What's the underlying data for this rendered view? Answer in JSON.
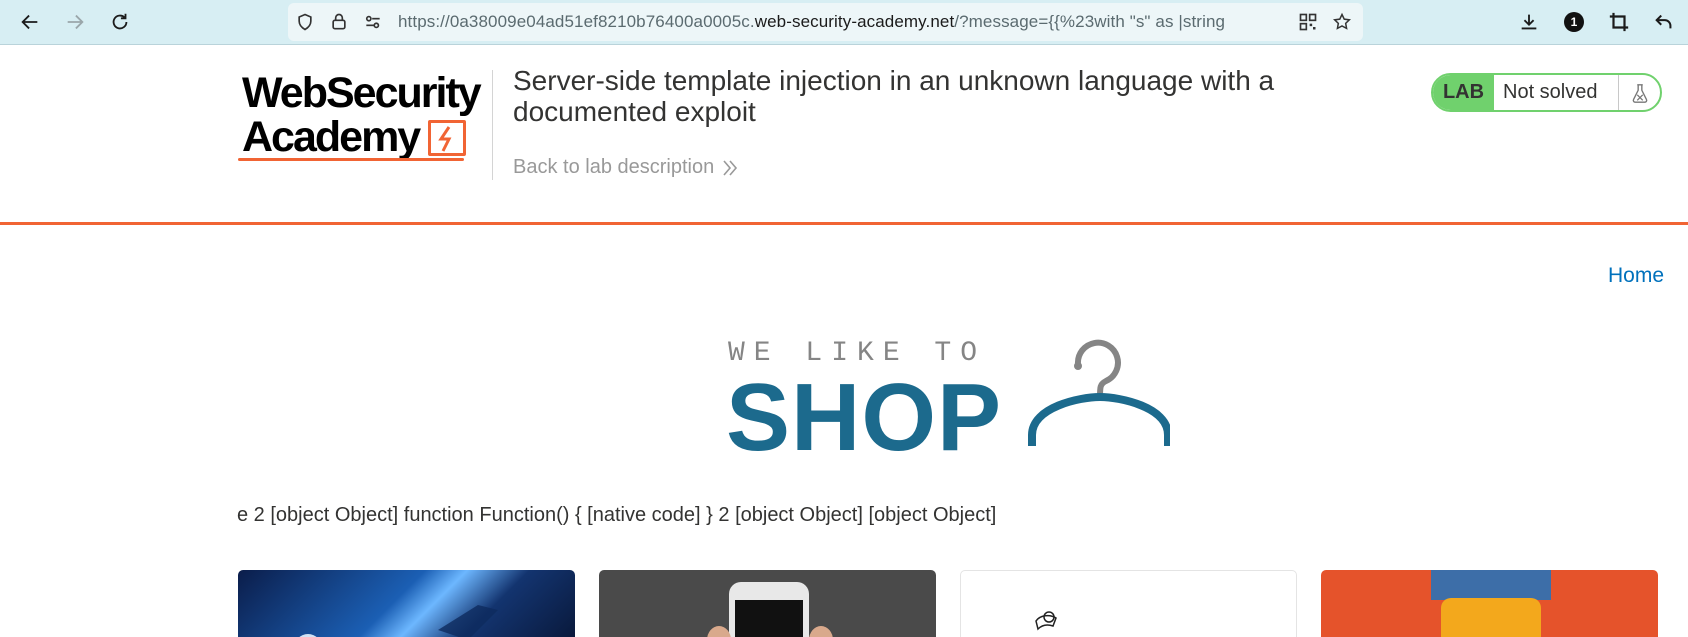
{
  "browser": {
    "url_prefix": "https://0a38009e04ad51ef8210b76400a0005c.",
    "url_host": "web-security-academy.net",
    "url_rest": "/?message={{%23with \"s\" as |string",
    "extension_badge": "1"
  },
  "lab_header": {
    "logo_line1": "WebSecurity",
    "logo_line2": "Academy",
    "title": "Server-side template injection in an unknown language with a documented exploit",
    "back_link": "Back to lab description",
    "lab_label": "LAB",
    "status": "Not solved"
  },
  "shop": {
    "home_link": "Home",
    "tagline": "WE LIKE TO",
    "brand": "SHOP",
    "message": "e 2 [object Object] function Function() { [native code] } 2 [object Object] [object Object]"
  },
  "colors": {
    "accent": "#f16434",
    "lab_green": "#70d16d",
    "shop_blue": "#1c6a8d",
    "link_blue": "#0071bc"
  }
}
